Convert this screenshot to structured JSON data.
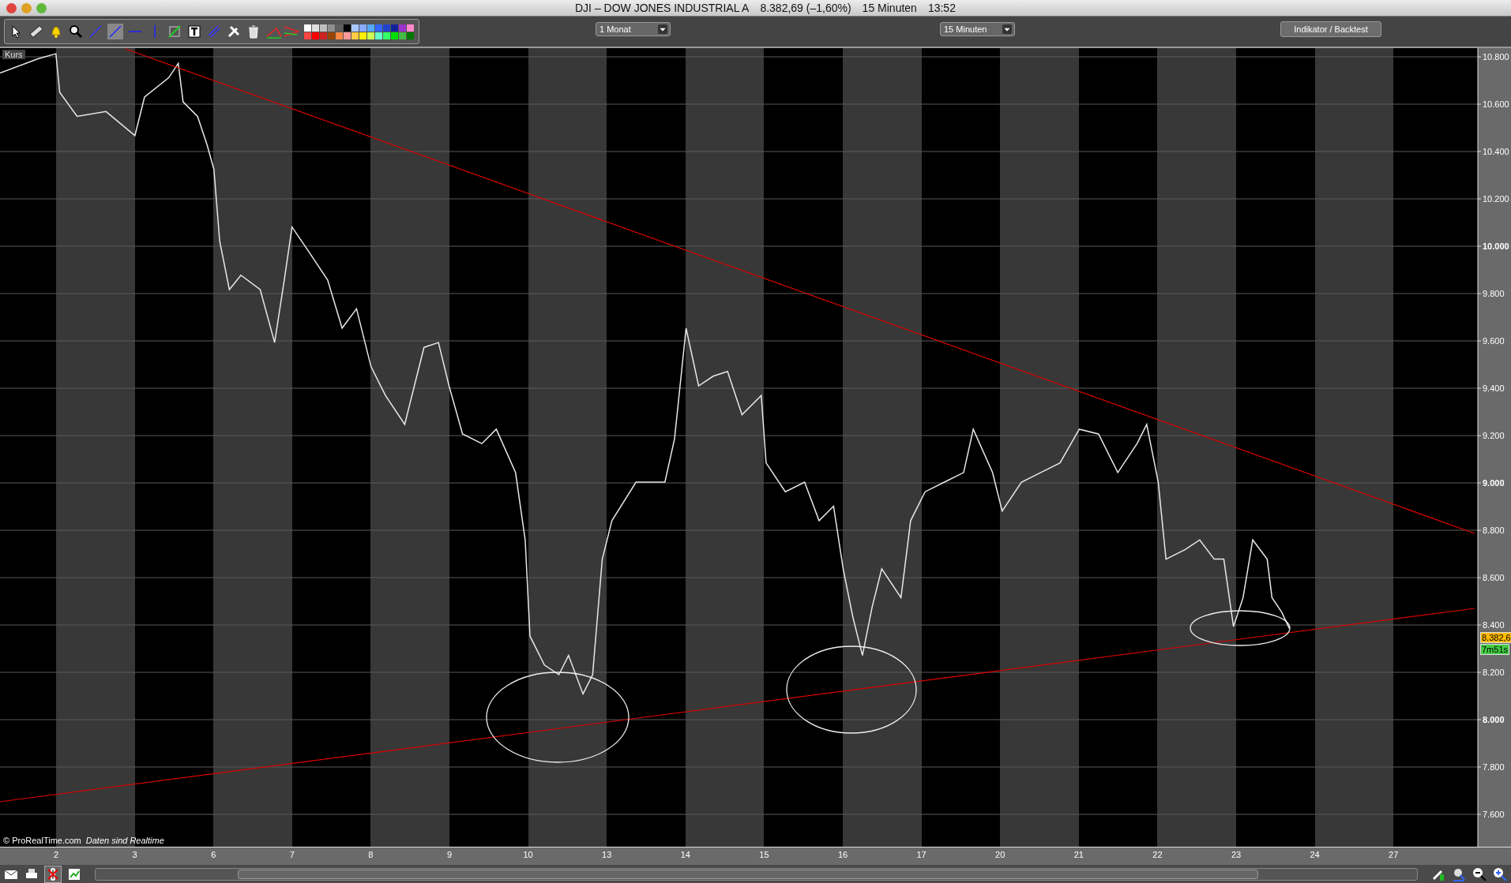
{
  "window": {
    "title": "DJI – DOW JONES INDUSTRIAL A",
    "price": "8.382,69 (–1,60%)",
    "interval": "15 Minuten",
    "time": "13:52"
  },
  "toolbar": {
    "period_select": "1 Monat",
    "interval_select": "15 Minuten",
    "indicator_button": "Indikator / Backtest"
  },
  "chart": {
    "label": "Kurs",
    "last_price": "8.382,6",
    "countdown": "7m51s",
    "copyright": "© ProRealTime.com",
    "realtime_note": "Daten sind Realtime",
    "x_axis_labels": [
      "2",
      "3",
      "6",
      "7",
      "8",
      "9",
      "10",
      "13",
      "14",
      "15",
      "16",
      "17",
      "20",
      "21",
      "22",
      "23",
      "24",
      "27"
    ],
    "y_axis_labels": [
      {
        "label": "10.800",
        "major": false
      },
      {
        "label": "10.600",
        "major": false
      },
      {
        "label": "10.400",
        "major": false
      },
      {
        "label": "10.200",
        "major": false
      },
      {
        "label": "10.000",
        "major": true
      },
      {
        "label": "9.800",
        "major": false
      },
      {
        "label": "9.600",
        "major": false
      },
      {
        "label": "9.400",
        "major": false
      },
      {
        "label": "9.200",
        "major": false
      },
      {
        "label": "9.000",
        "major": true
      },
      {
        "label": "8.800",
        "major": false
      },
      {
        "label": "8.600",
        "major": false
      },
      {
        "label": "8.400",
        "major": false
      },
      {
        "label": "8.200",
        "major": false
      },
      {
        "label": "8.000",
        "major": true
      },
      {
        "label": "7.800",
        "major": false
      },
      {
        "label": "7.600",
        "major": false
      }
    ]
  }
}
